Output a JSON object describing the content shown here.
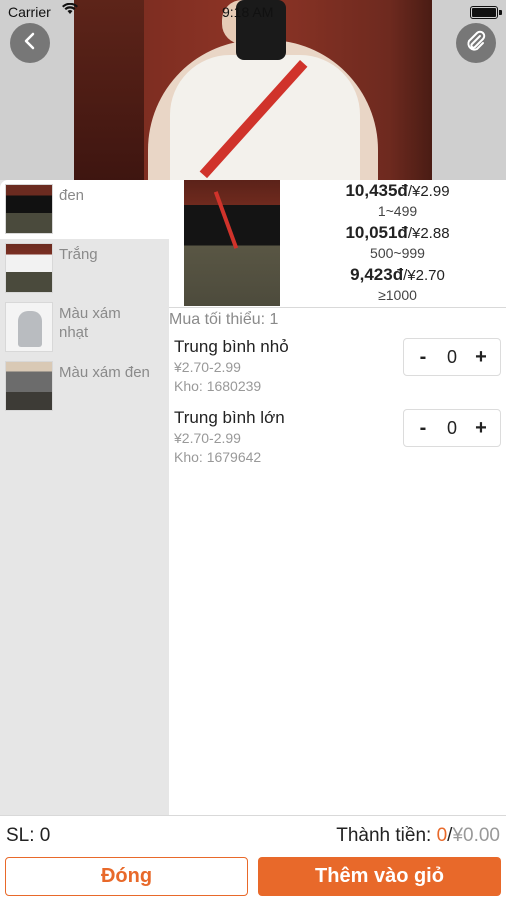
{
  "status_bar": {
    "carrier": "Carrier",
    "time": "9:18 AM"
  },
  "header": {
    "back_icon": "chevron-left-icon",
    "attach_icon": "paperclip-icon"
  },
  "variants": [
    {
      "name": "đen",
      "thumb": "black"
    },
    {
      "name": "Trắng",
      "thumb": "white"
    },
    {
      "name": "Màu xám nhạt",
      "thumb": "gray"
    },
    {
      "name": "Màu xám đen",
      "thumb": "dark"
    }
  ],
  "price_tiers": [
    {
      "vnd": "10,435đ",
      "cny": "/¥2.99",
      "range": "1~499"
    },
    {
      "vnd": "10,051đ",
      "cny": "/¥2.88",
      "range": "500~999"
    },
    {
      "vnd": "9,423đ",
      "cny": "/¥2.70",
      "range": "≥1000"
    }
  ],
  "min_purchase": "Mua tối thiểu: 1",
  "sizes": [
    {
      "name": "Trung bình nhỏ",
      "price": "¥2.70-2.99",
      "stock": "Kho: 1680239",
      "qty": "0"
    },
    {
      "name": "Trung bình lớn",
      "price": "¥2.70-2.99",
      "stock": "Kho: 1679642",
      "qty": "0"
    }
  ],
  "stepper": {
    "minus": "-",
    "plus": "+"
  },
  "footer": {
    "quantity_label": "SL: 0",
    "total_label": "Thành tiền: ",
    "total_qty": "0",
    "total_sep": "/",
    "total_amount": "¥0.00",
    "close_button": "Đóng",
    "add_button": "Thêm vào giỏ"
  },
  "colors": {
    "accent": "#e8692a",
    "sidebar_bg": "#e6e6e6"
  }
}
